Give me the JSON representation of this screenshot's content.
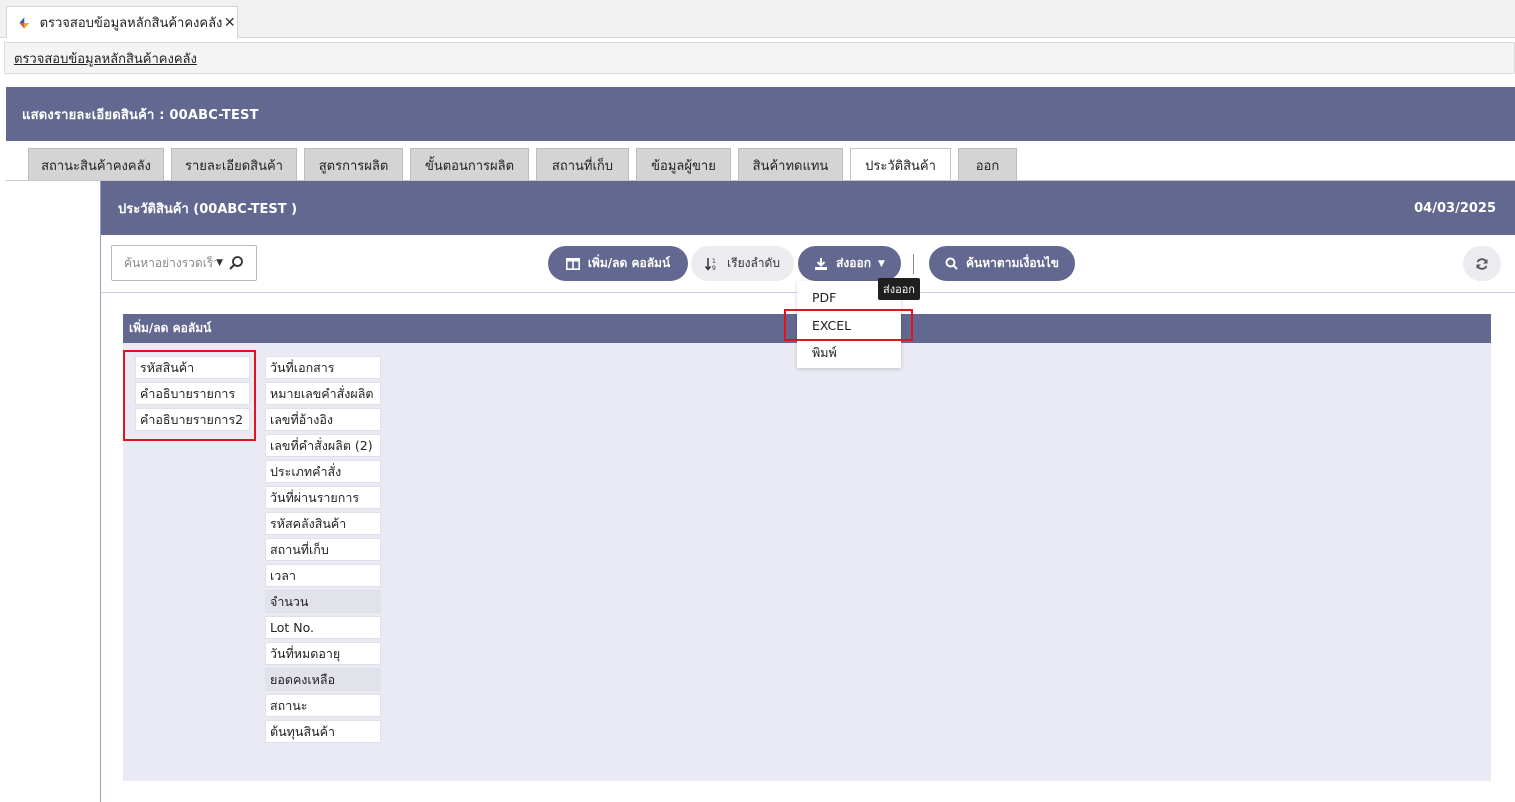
{
  "window": {
    "tab_title": "ตรวจสอบข้อมูลหลักสินค้าคงคลัง",
    "close_glyph": "✕"
  },
  "breadcrumb": {
    "label": "ตรวจสอบข้อมูลหลักสินค้าคงคลัง"
  },
  "page": {
    "title": "แสดงรายละเอียดสินค้า : 00ABC-TEST"
  },
  "tabs": [
    {
      "label": "สถานะสินค้าคงคลัง",
      "active": false
    },
    {
      "label": "รายละเอียดสินค้า",
      "active": false
    },
    {
      "label": "สูตรการผลิต",
      "active": false
    },
    {
      "label": "ขั้นตอนการผลิต",
      "active": false
    },
    {
      "label": "สถานที่เก็บ",
      "active": false
    },
    {
      "label": "ข้อมูลผู้ขาย",
      "active": false
    },
    {
      "label": "สินค้าทดแทน",
      "active": false
    },
    {
      "label": "ประวัติสินค้า",
      "active": true
    },
    {
      "label": "ออก",
      "active": false
    }
  ],
  "panel": {
    "title": "ประวัติสินค้า (00ABC-TEST )",
    "date": "04/03/2025"
  },
  "toolbar": {
    "search_placeholder": "ค้นหาอย่างรวดเร็ว",
    "columns_button": "เพิ่ม/ลด คอลัมน์",
    "sort_button": "เรียงลำดับ",
    "export_button": "ส่งออก",
    "filter_button": "ค้นหาตามเงื่อนไข",
    "export_tooltip": "ส่งออก"
  },
  "export_menu": {
    "items": [
      "PDF",
      "EXCEL",
      "พิมพ์"
    ],
    "highlighted": "EXCEL"
  },
  "column_chooser": {
    "title": "เพิ่ม/ลด คอลัมน์",
    "selected": [
      "รหัสสินค้า",
      "คำอธิบายรายการ",
      "คำอธิบายรายการ2"
    ],
    "available": [
      "วันที่เอกสาร",
      "หมายเลขคำสั่งผลิต",
      "เลขที่อ้างอิง",
      "เลขที่คำสั่งผลิต (2)",
      "ประเภทคำสั่ง",
      "วันที่ผ่านรายการ",
      "รหัสคลังสินค้า",
      "สถานที่เก็บ",
      "เวลา",
      "จำนวน",
      "Lot No.",
      "วันที่หมดอายุ",
      "ยอดคงเหลือ",
      "สถานะ",
      "ต้นทุนสินค้า"
    ]
  },
  "colors": {
    "header": "#62688f",
    "panel_bg": "#e9eaf3",
    "highlight_red": "#e0141e"
  }
}
